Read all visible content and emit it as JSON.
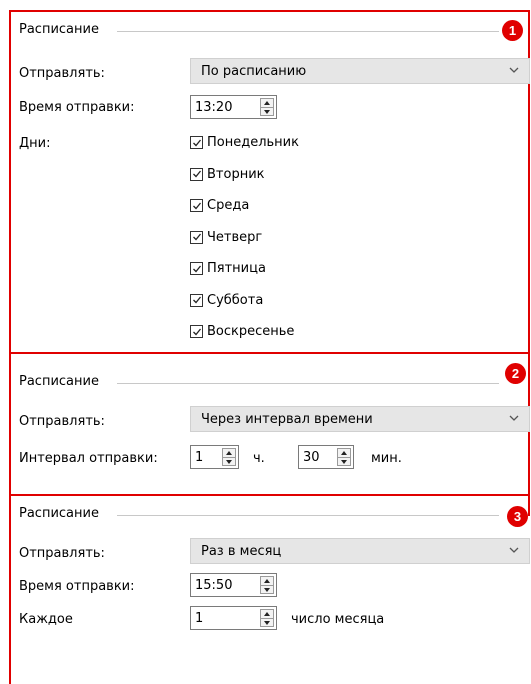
{
  "panel1": {
    "badge": "1",
    "title": "Расписание",
    "send_label": "Отправлять:",
    "send_value": "По расписанию",
    "time_label": "Время отправки:",
    "time_value": "13:20",
    "days_label": "Дни:",
    "days": [
      {
        "label": "Понедельник",
        "checked": true
      },
      {
        "label": "Вторник",
        "checked": true
      },
      {
        "label": "Среда",
        "checked": true
      },
      {
        "label": "Четверг",
        "checked": true
      },
      {
        "label": "Пятница",
        "checked": true
      },
      {
        "label": "Суббота",
        "checked": true
      },
      {
        "label": "Воскресенье",
        "checked": true
      }
    ]
  },
  "panel2": {
    "badge": "2",
    "title": "Расписание",
    "send_label": "Отправлять:",
    "send_value": "Через интервал времени",
    "interval_label": "Интервал отправки:",
    "hours_value": "1",
    "hours_unit": "ч.",
    "minutes_value": "30",
    "minutes_unit": "мин."
  },
  "panel3": {
    "badge": "3",
    "title": "Расписание",
    "send_label": "Отправлять:",
    "send_value": "Раз в месяц",
    "time_label": "Время отправки:",
    "time_value": "15:50",
    "each_label": "Каждое",
    "day_value": "1",
    "day_unit": "число месяца"
  },
  "colors": {
    "accent": "#e00000"
  }
}
